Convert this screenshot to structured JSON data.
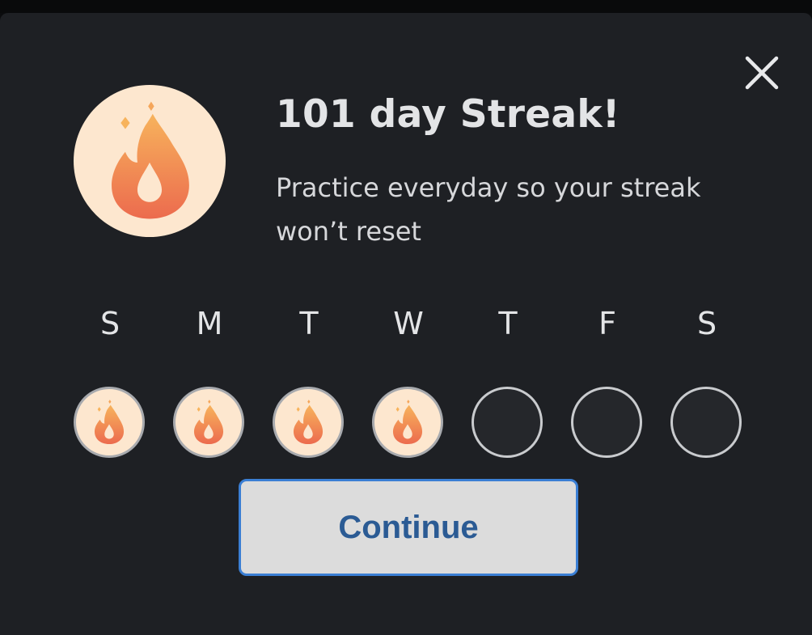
{
  "modal": {
    "title": "101 day Streak!",
    "subtitle": "Practice everyday so your streak won’t reset",
    "continue_label": "Continue",
    "icon": "fire-icon",
    "close_icon": "close-icon"
  },
  "week": {
    "days": [
      {
        "label": "S",
        "completed": true
      },
      {
        "label": "M",
        "completed": true
      },
      {
        "label": "T",
        "completed": true
      },
      {
        "label": "W",
        "completed": true
      },
      {
        "label": "T",
        "completed": false
      },
      {
        "label": "F",
        "completed": false
      },
      {
        "label": "S",
        "completed": false
      }
    ]
  },
  "colors": {
    "background": "#1e2024",
    "badge_fill": "#fde7cf",
    "flame_top": "#f7b35c",
    "flame_bottom": "#ec6b4e",
    "button_text": "#2b5b94",
    "button_border": "#3b7fd4"
  }
}
